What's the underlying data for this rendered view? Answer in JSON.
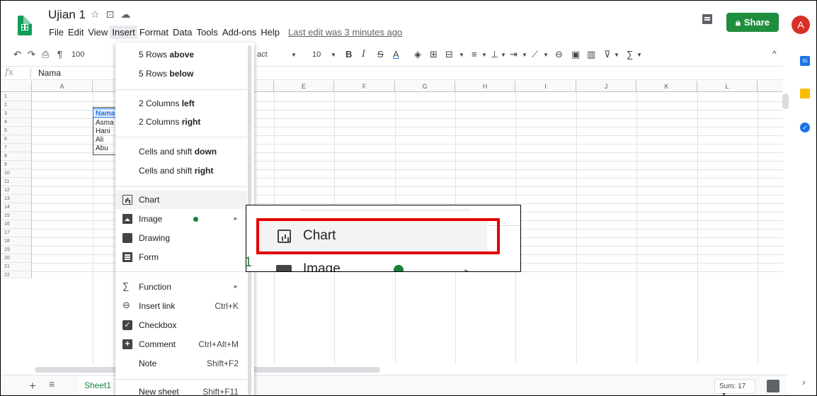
{
  "app": {
    "doc_title": "Ujian 1",
    "title_icons": [
      "star-icon",
      "move-to-folder-icon",
      "cloud-saved-icon"
    ],
    "menus": [
      "File",
      "Edit",
      "View",
      "Insert",
      "Format",
      "Data",
      "Tools",
      "Add-ons",
      "Help"
    ],
    "active_menu": "Insert",
    "last_edit": "Last edit was 3 minutes ago",
    "share_label": "Share",
    "avatar_letter": "A",
    "accent_color": "#1e8e3e"
  },
  "toolbar": {
    "zoom_fragment": "100",
    "font_fragment": "act",
    "font_size": "10",
    "bold": "B",
    "italic": "I",
    "strikethrough": "S",
    "text_color": "A",
    "collapse": "^"
  },
  "formula_bar": {
    "fx": "fx",
    "value": "Nama"
  },
  "grid": {
    "columns": [
      "A",
      "B",
      "C",
      "D",
      "E",
      "F",
      "G",
      "H",
      "I",
      "J",
      "K",
      "L"
    ],
    "rows": [
      "1",
      "2",
      "3",
      "4",
      "5",
      "6",
      "7",
      "8",
      "9",
      "10",
      "11",
      "12",
      "13",
      "14",
      "15",
      "16",
      "17",
      "18",
      "19",
      "20",
      "21",
      "22"
    ],
    "cells_b": [
      "Nama",
      "Asma",
      "Hani",
      "Ali",
      "Abu"
    ]
  },
  "insert_menu": {
    "items": [
      {
        "label": "5 Rows ",
        "bold": "above"
      },
      {
        "label": "5 Rows ",
        "bold": "below"
      },
      {
        "label": "2 Columns ",
        "bold": "left"
      },
      {
        "label": "2 Columns ",
        "bold": "right"
      },
      {
        "label": "Cells and shift ",
        "bold": "down"
      },
      {
        "label": "Cells and shift ",
        "bold": "right"
      }
    ],
    "chart": "Chart",
    "image": "Image",
    "drawing": "Drawing",
    "form": "Form",
    "function": "Function",
    "insert_link": "Insert link",
    "insert_link_shortcut": "Ctrl+K",
    "checkbox": "Checkbox",
    "comment": "Comment",
    "comment_shortcut": "Ctrl+Alt+M",
    "note": "Note",
    "note_shortcut": "Shift+F2",
    "new_sheet": "New sheet",
    "new_sheet_shortcut": "Shift+F11",
    "function_symbol": "∑"
  },
  "zoom_callout": {
    "chart_label": "Chart",
    "image_label": "Image",
    "edge_text": "t1"
  },
  "sheetbar": {
    "sheet_name": "Sheet1",
    "sum_label": "Sum: 17"
  }
}
